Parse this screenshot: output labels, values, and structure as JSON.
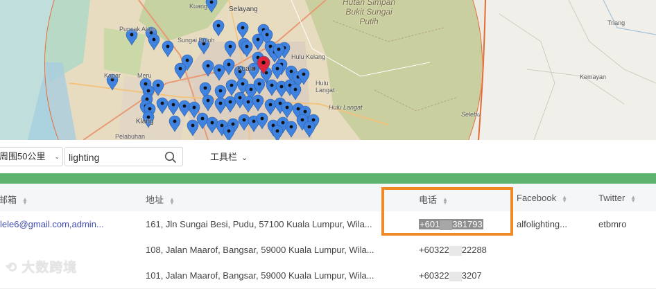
{
  "map": {
    "places": [
      {
        "id": "selayang",
        "label": "Selayang"
      },
      {
        "id": "kuang",
        "label": "Kuang"
      },
      {
        "id": "puncak-alam",
        "label": "Puncak Alam"
      },
      {
        "id": "sungai-buloh",
        "label": "Sungai Buloh"
      },
      {
        "id": "meru",
        "label": "Meru"
      },
      {
        "id": "kapar",
        "label": "Kapar"
      },
      {
        "id": "klang",
        "label": "Klang"
      },
      {
        "id": "pelabuhan",
        "label": "Pelabuhan"
      },
      {
        "id": "hulu-kelang",
        "label": "Hulu Kelang"
      },
      {
        "id": "langat",
        "label": "Hulu\nLangat"
      },
      {
        "id": "hulu-langat",
        "label": "Hulu Langat"
      },
      {
        "id": "selebu",
        "label": "Selebu"
      },
      {
        "id": "hutan",
        "label": "Hutan Simpan\nBukit Sungai\nPutih"
      },
      {
        "id": "triang",
        "label": "Triang"
      },
      {
        "id": "kemayan",
        "label": "Kemayan"
      },
      {
        "id": "kl",
        "label": "Kuala"
      }
    ]
  },
  "toolbar": {
    "radius_label": "周围50公里",
    "search_value": "lighting",
    "menu_label": "工具栏"
  },
  "table": {
    "headers": {
      "email": "邮箱",
      "address": "地址",
      "phone": "电话",
      "facebook": "Facebook",
      "twitter": "Twitter"
    },
    "rows": [
      {
        "email": "lele6@gmail.com,admin...",
        "address": "161, Jln Sungai Besi, Pudu, 57100 Kuala Lumpur, Wila...",
        "phone_a": "+601",
        "phone_b": "381793",
        "facebook": "alfolighting...",
        "twitter": "etbmro"
      },
      {
        "email": "",
        "address": "108, Jalan Maarof, Bangsar, 59000 Kuala Lumpur, Wila...",
        "phone_a": "+60322",
        "phone_b": "22288",
        "facebook": "",
        "twitter": ""
      },
      {
        "email": "",
        "address": "101, Jalan Maarof, Bangsar, 59000 Kuala Lumpur, Wila...",
        "phone_a": "+60322",
        "phone_b": "3207",
        "facebook": "",
        "twitter": ""
      }
    ]
  },
  "watermark": "大数跨境",
  "colors": {
    "accent_green": "#5cb46e",
    "highlight_orange": "#f08a26",
    "pin_blue": "#3f82e0",
    "pin_red": "#e0243b"
  }
}
